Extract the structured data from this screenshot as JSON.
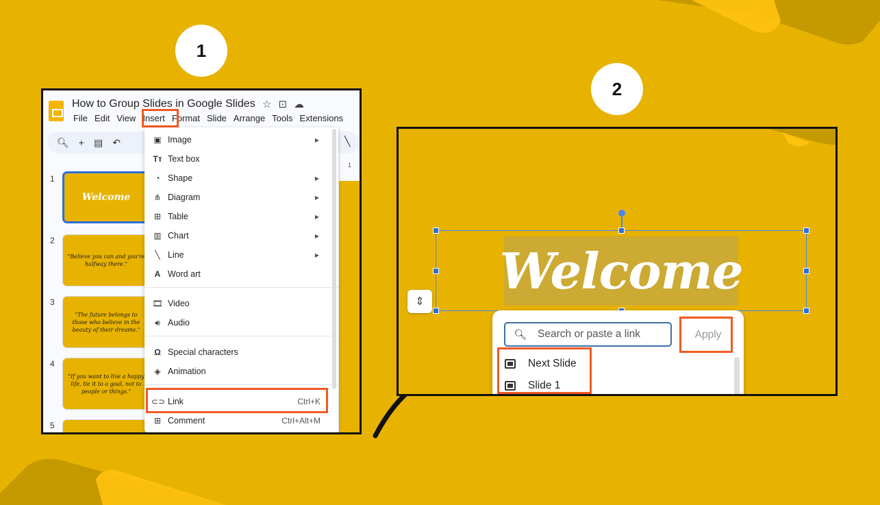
{
  "badges": {
    "step1": "1",
    "step2": "2"
  },
  "panel1": {
    "doc_title": "How to Group Slides in Google Slides",
    "menubar": [
      "File",
      "Edit",
      "View",
      "Insert",
      "Format",
      "Slide",
      "Arrange",
      "Tools",
      "Extensions"
    ],
    "ruler_mark": "1",
    "slides": [
      {
        "num": "1",
        "text": "Welcome"
      },
      {
        "num": "2",
        "text": "\"Believe you can and you're halfway there.\""
      },
      {
        "num": "3",
        "text": "\"The future belongs to those who believe in the beauty of their dreams.\""
      },
      {
        "num": "4",
        "text": "\"If you want to live a happy life, tie it to a goal, not to people or things.\""
      },
      {
        "num": "5",
        "text": ""
      }
    ],
    "insert_menu": {
      "items": [
        {
          "label": "Image",
          "icon": "image-icon",
          "submenu": true
        },
        {
          "label": "Text box",
          "icon": "text-box-icon",
          "submenu": false
        },
        {
          "label": "Shape",
          "icon": "shape-icon",
          "submenu": true
        },
        {
          "label": "Diagram",
          "icon": "diagram-icon",
          "submenu": true
        },
        {
          "label": "Table",
          "icon": "table-icon",
          "submenu": true
        },
        {
          "label": "Chart",
          "icon": "chart-icon",
          "submenu": true
        },
        {
          "label": "Line",
          "icon": "line-icon",
          "submenu": true
        },
        {
          "label": "Word art",
          "icon": "word-art-icon",
          "submenu": false
        },
        {
          "label": "Video",
          "icon": "video-icon",
          "submenu": false
        },
        {
          "label": "Audio",
          "icon": "audio-icon",
          "submenu": false
        },
        {
          "label": "Special characters",
          "icon": "omega-icon",
          "submenu": false
        },
        {
          "label": "Animation",
          "icon": "animation-icon",
          "submenu": false
        },
        {
          "label": "Link",
          "icon": "link-icon",
          "shortcut": "Ctrl+K"
        },
        {
          "label": "Comment",
          "icon": "comment-icon",
          "shortcut": "Ctrl+Alt+M"
        }
      ]
    }
  },
  "panel2": {
    "slide_title": "Welcome",
    "link_popup": {
      "search_placeholder": "Search or paste a link",
      "apply_label": "Apply",
      "suggestions": [
        "Next Slide",
        "Slide 1"
      ]
    }
  },
  "colors": {
    "background": "#E8B200",
    "highlight": "#F15A22",
    "selection": "#2A6FD8"
  }
}
